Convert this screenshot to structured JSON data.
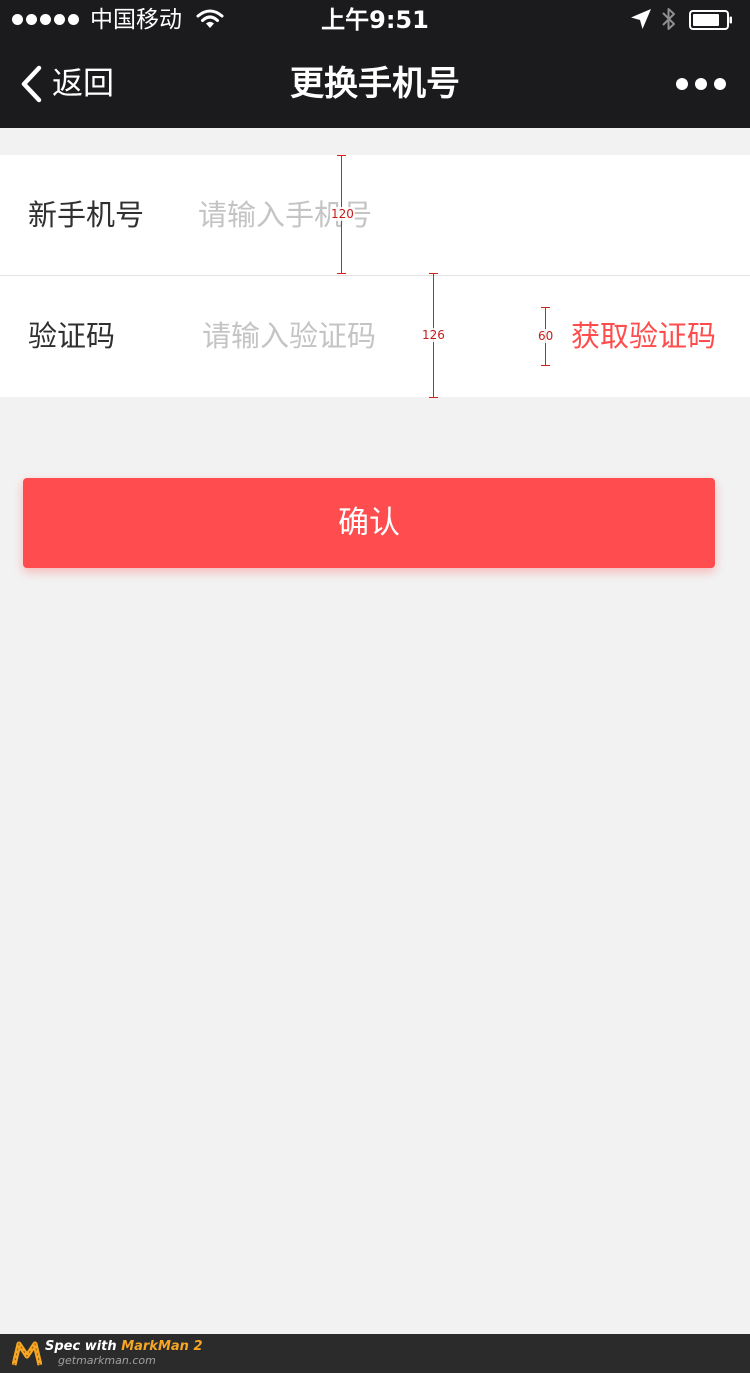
{
  "status_bar": {
    "carrier": "中国移动",
    "time": "上午9:51"
  },
  "nav": {
    "back_label": "返回",
    "title": "更换手机号"
  },
  "form": {
    "phone": {
      "label": "新手机号",
      "placeholder": "请输入手机号",
      "value": ""
    },
    "code": {
      "label": "验证码",
      "placeholder": "请输入验证码",
      "value": "",
      "get_code_label": "获取验证码"
    }
  },
  "confirm_label": "确认",
  "spec_annotations": {
    "row1_height": "120",
    "row2_height": "126",
    "input_height": "60"
  },
  "watermark": {
    "line1_prefix": "Spec with ",
    "line1_brand": "MarkMan 2",
    "line2": "getmarkman.com"
  },
  "colors": {
    "nav_background": "#1b1b1d",
    "page_background": "#f2f2f2",
    "accent": "#ff4c4e",
    "placeholder": "#c4c4c4",
    "label": "#303030"
  },
  "icons": {
    "back": "chevron-left-icon",
    "more": "more-dots-icon",
    "wifi": "wifi-icon",
    "location": "location-arrow-icon",
    "bluetooth": "bluetooth-icon",
    "battery": "battery-icon"
  }
}
